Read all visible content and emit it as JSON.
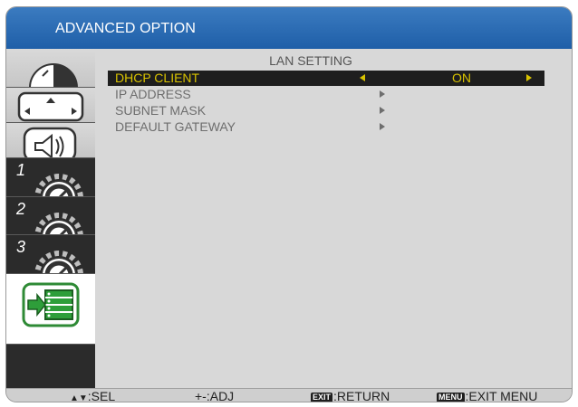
{
  "window": {
    "title": "ADVANCED OPTION"
  },
  "sidebar": {
    "items": [
      {
        "icon": "picture-icon"
      },
      {
        "icon": "screen-position-icon"
      },
      {
        "icon": "audio-icon"
      },
      {
        "number": "1",
        "icon": "config1-gauge-icon"
      },
      {
        "number": "2",
        "icon": "config2-gauge-icon"
      },
      {
        "number": "3",
        "icon": "config3-gauge-icon"
      },
      {
        "icon": "advanced-option-icon",
        "active": true
      }
    ]
  },
  "section": {
    "title": "LAN SETTING"
  },
  "menu": {
    "items": [
      {
        "label": "DHCP CLIENT",
        "value": "ON",
        "selected": true
      },
      {
        "label": "IP ADDRESS"
      },
      {
        "label": "SUBNET MASK"
      },
      {
        "label": "DEFAULT GATEWAY"
      }
    ]
  },
  "footer": {
    "sel": ":SEL",
    "adj": "+-:ADJ",
    "exit_key": "EXIT",
    "return": ":RETURN",
    "menu_key": "MENU",
    "exit_menu": ":EXIT MENU"
  },
  "colors": {
    "title_bar": "#2a6bb3",
    "selected_row_bg": "#1e1e1e",
    "selected_text": "#d8c200",
    "menu_text": "#6e6e6e",
    "active_icon": "#2e9e3a"
  }
}
